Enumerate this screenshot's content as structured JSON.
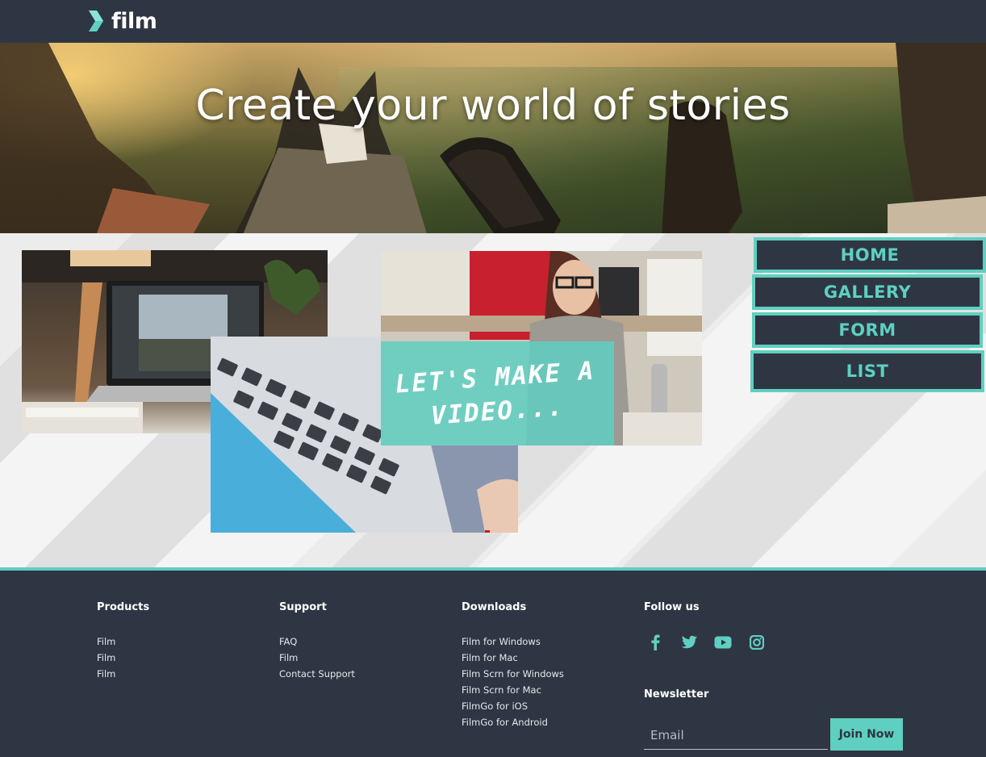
{
  "brand": {
    "name": "film",
    "accent": "#5fcfc1",
    "dark": "#2e3643"
  },
  "hero": {
    "title": "Create your world of stories"
  },
  "gallery": {
    "overlay_text": "LET'S MAKE A VIDEO..."
  },
  "nav": {
    "items": [
      {
        "label": "HOME"
      },
      {
        "label": "GALLERY"
      },
      {
        "label": "FORM"
      },
      {
        "label": "LIST"
      }
    ]
  },
  "footer": {
    "products": {
      "heading": "Products",
      "links": [
        "Film",
        "Film",
        "Film"
      ]
    },
    "support": {
      "heading": "Support",
      "links": [
        "FAQ",
        "Film",
        "Contact Support"
      ]
    },
    "downloads": {
      "heading": "Downloads",
      "links": [
        "Film for Windows",
        "Film for Mac",
        "Film Scrn for Windows",
        "Film Scrn for Mac",
        "FilmGo for iOS",
        "FilmGo for Android"
      ]
    },
    "follow": {
      "heading": "Follow us",
      "icons": [
        "facebook-icon",
        "twitter-icon",
        "youtube-icon",
        "instagram-icon"
      ]
    },
    "newsletter": {
      "heading": "Newsletter",
      "email_placeholder": "Email",
      "button_label": "Join Now"
    }
  }
}
